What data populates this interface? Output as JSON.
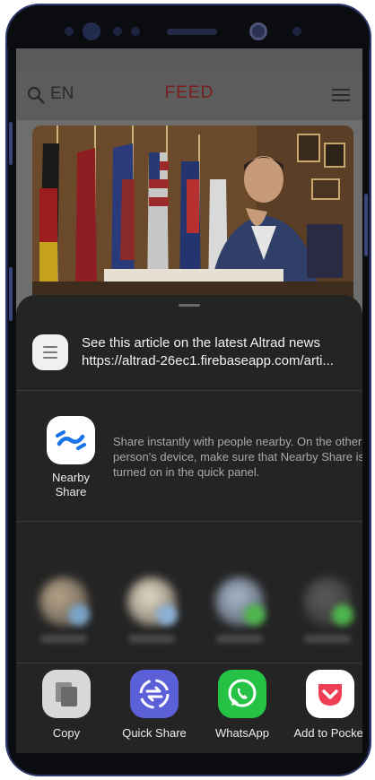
{
  "app": {
    "lang_label": "EN",
    "title": "FEED"
  },
  "share_sheet": {
    "link": {
      "title": "See this article on the latest Altrad news",
      "url": "https://altrad-26ec1.firebaseapp.com/arti..."
    },
    "nearby": {
      "label": "Nearby Share",
      "description": "Share instantly with people nearby. On the other person's device, make sure that Nearby Share is turned on in the quick panel."
    },
    "apps": [
      {
        "label": "Copy",
        "icon": "copy-icon"
      },
      {
        "label": "Quick Share",
        "icon": "quick-share-icon"
      },
      {
        "label": "WhatsApp",
        "icon": "whatsapp-icon"
      },
      {
        "label": "Add to Pocket",
        "icon": "pocket-icon"
      }
    ]
  },
  "colors": {
    "sheet_background": "#242424",
    "app_title_red": "#b3262a",
    "whatsapp_green": "#25c245",
    "quick_share_purple": "#5b5fd8",
    "pocket_red": "#ef3f56",
    "nearby_blue": "#1a73e8"
  }
}
